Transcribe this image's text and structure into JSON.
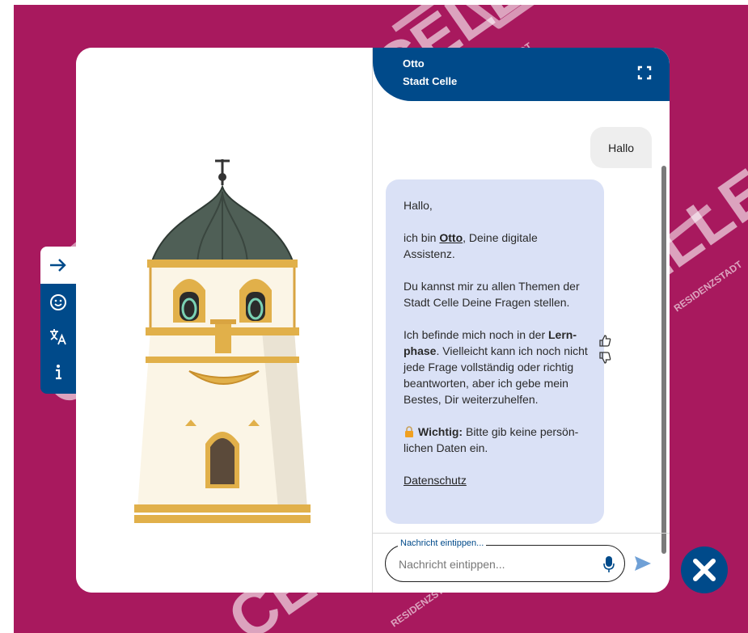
{
  "header": {
    "bot_name": "Otto",
    "bot_subtitle": "Stadt Celle"
  },
  "messages": {
    "user": "Hallo",
    "bot": {
      "greeting": "Hallo,",
      "intro_prefix": "ich bin ",
      "intro_name": "Otto",
      "intro_suffix": ", Deine digitale Assistenz.",
      "topics": "Du kannst mir zu allen Themen der Stadt Celle Deine Fragen stellen.",
      "learn_prefix": "Ich befinde mich noch in der ",
      "learn_bold": "Lern-phase",
      "learn_suffix": ". Vielleicht kann ich noch nicht jede Frage vollständig oder richtig beantworten, aber ich gebe mein Bestes, Dir weiterzuhelfen.",
      "important_icon": "lock-icon",
      "important_label": "Wichtig:",
      "important_text": " Bitte gib keine persön-lichen Daten ein.",
      "privacy_link": "Datenschutz"
    }
  },
  "input": {
    "label": "Nachricht eintippen...",
    "placeholder": "Nachricht eintippen..."
  },
  "icons": {
    "fullscreen": "fullscreen-icon",
    "thumbs_up": "thumbs-up-icon",
    "thumbs_down": "thumbs-down-icon",
    "microphone": "microphone-icon",
    "send": "send-icon",
    "arrow": "arrow-right-icon",
    "emoji": "emoji-icon",
    "translate": "translate-icon",
    "info": "info-icon",
    "close": "close-icon"
  },
  "watermark": {
    "word": "CELLE",
    "tagline": "RESIDENZSTADT"
  },
  "colors": {
    "background": "#a8195e",
    "primary": "#004a8a",
    "bot_bubble": "#dae1f6",
    "user_bubble": "#eeeeee",
    "send_arrow": "#6fa0d6"
  }
}
